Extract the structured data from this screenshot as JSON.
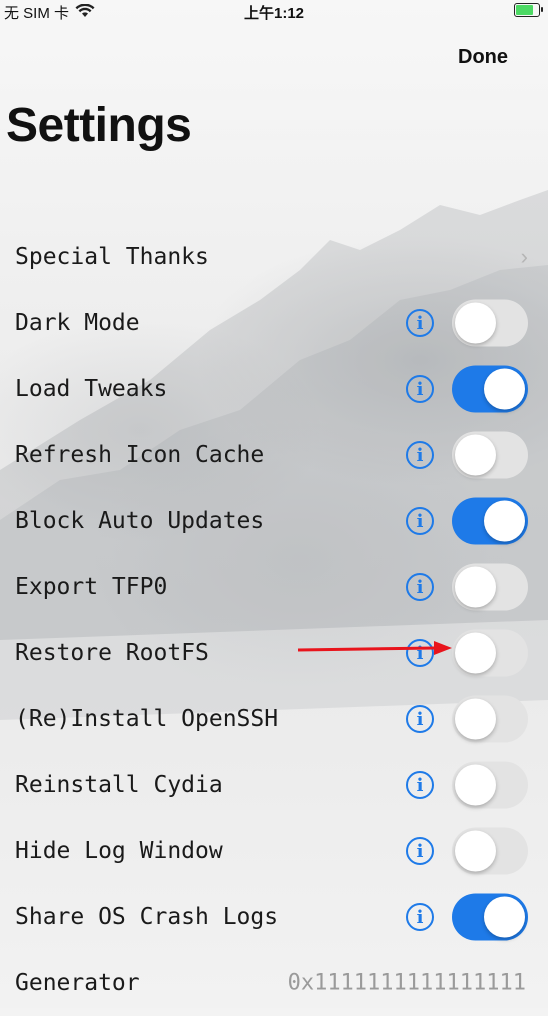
{
  "status_bar": {
    "carrier": "无 SIM 卡",
    "time": "上午1:12"
  },
  "nav": {
    "done_label": "Done"
  },
  "page_title": "Settings",
  "rows": [
    {
      "label": "Special Thanks",
      "type": "disclosure"
    },
    {
      "label": "Dark Mode",
      "type": "toggle",
      "on": false
    },
    {
      "label": "Load Tweaks",
      "type": "toggle",
      "on": true
    },
    {
      "label": "Refresh Icon Cache",
      "type": "toggle",
      "on": false
    },
    {
      "label": "Block Auto Updates",
      "type": "toggle",
      "on": true
    },
    {
      "label": "Export TFP0",
      "type": "toggle",
      "on": false
    },
    {
      "label": "Restore RootFS",
      "type": "toggle",
      "on": false
    },
    {
      "label": "(Re)Install OpenSSH",
      "type": "toggle",
      "on": false
    },
    {
      "label": "Reinstall Cydia",
      "type": "toggle",
      "on": false
    },
    {
      "label": "Hide Log Window",
      "type": "toggle",
      "on": false
    },
    {
      "label": "Share OS Crash Logs",
      "type": "toggle",
      "on": true
    },
    {
      "label": "Generator",
      "type": "value",
      "value": "0x1111111111111111"
    }
  ],
  "colors": {
    "accent": "#1e7ae8",
    "annotation_arrow": "#e8141c"
  }
}
